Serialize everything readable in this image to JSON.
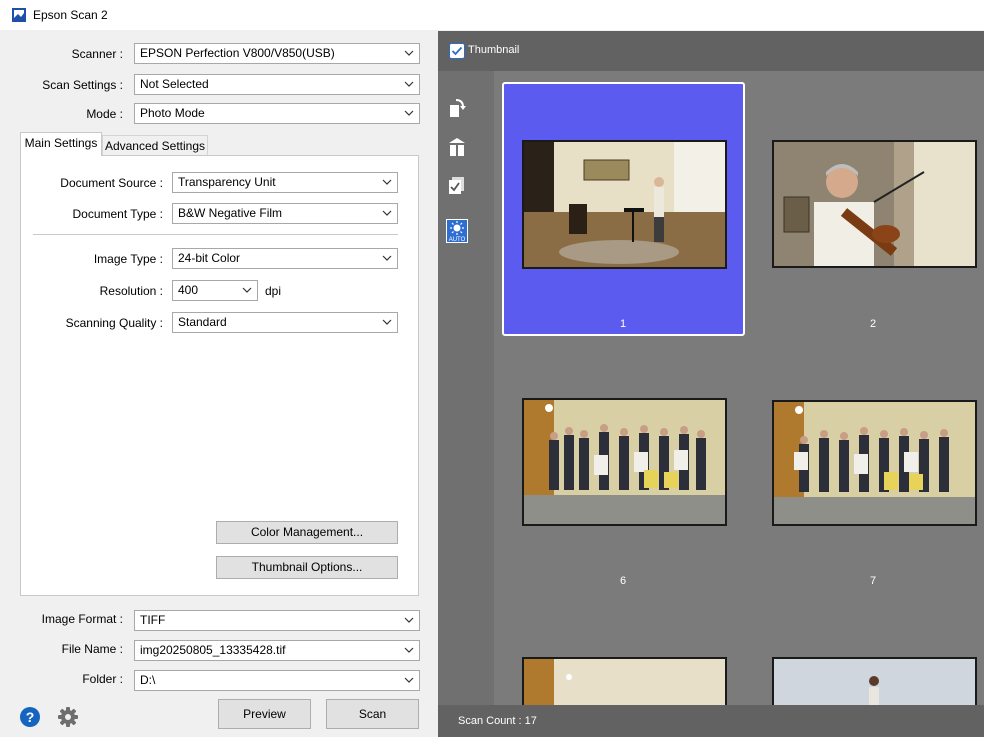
{
  "window": {
    "title": "Epson Scan 2"
  },
  "settings": {
    "scanner_label": "Scanner :",
    "scanner_value": "EPSON Perfection V800/V850(USB)",
    "scan_settings_label": "Scan Settings :",
    "scan_settings_value": "Not Selected",
    "mode_label": "Mode :",
    "mode_value": "Photo Mode"
  },
  "tabs": {
    "main": "Main Settings",
    "advanced": "Advanced Settings"
  },
  "main_settings": {
    "doc_source_label": "Document Source :",
    "doc_source_value": "Transparency Unit",
    "doc_type_label": "Document Type :",
    "doc_type_value": "B&W Negative Film",
    "image_type_label": "Image Type :",
    "image_type_value": "24-bit Color",
    "resolution_label": "Resolution :",
    "resolution_value": "400",
    "resolution_unit": "dpi",
    "quality_label": "Scanning Quality :",
    "quality_value": "Standard",
    "color_mgmt_button": "Color Management...",
    "thumb_options_button": "Thumbnail Options..."
  },
  "output": {
    "format_label": "Image Format :",
    "format_value": "TIFF",
    "filename_label": "File Name :",
    "filename_value": "img20250805_13335428.tif",
    "folder_label": "Folder :",
    "folder_value": "D:\\"
  },
  "actions": {
    "preview": "Preview",
    "scan": "Scan"
  },
  "preview": {
    "thumbnail_label": "Thumbnail",
    "thumbnail_checked": true,
    "auto_label": "AUTO",
    "scan_count": "Scan Count : 17",
    "frames": [
      {
        "label": "1",
        "selected": true,
        "scene": "room-with-violinist"
      },
      {
        "label": "2",
        "selected": false,
        "scene": "violinist-closeup"
      },
      {
        "label": "6",
        "selected": false,
        "scene": "group-photo"
      },
      {
        "label": "7",
        "selected": false,
        "scene": "group-photo"
      }
    ]
  },
  "colors": {
    "selected_tile": "#5b5bf0",
    "panel_dark": "#626262",
    "panel_mid": "#7b7b7b",
    "help_blue": "#1565c0"
  }
}
